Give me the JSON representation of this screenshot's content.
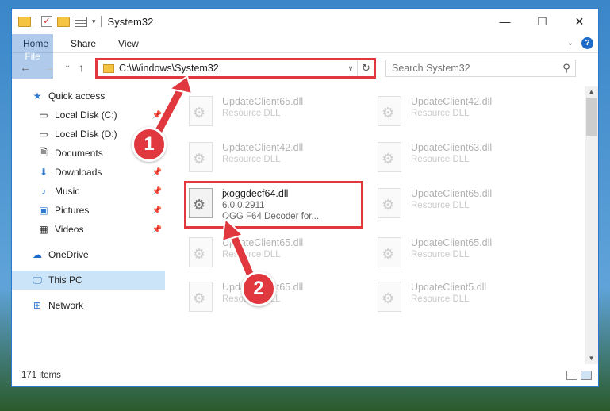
{
  "window": {
    "title": "System32",
    "controls": {
      "minimize": "—",
      "maximize": "☐",
      "close": "✕"
    }
  },
  "ribbon": {
    "tabs": [
      "File",
      "Home",
      "Share",
      "View"
    ],
    "expand_icon": "chevron-down-icon",
    "help": "?"
  },
  "nav": {
    "back": "←",
    "forward": "→",
    "recent": "⌄",
    "up": "↑",
    "address": "C:\\Windows\\System32",
    "search_placeholder": "Search System32"
  },
  "sidebar": {
    "items": [
      {
        "label": "Quick access",
        "icon": "star-icon",
        "pinned": false
      },
      {
        "label": "Local Disk (C:)",
        "icon": "drive-icon",
        "pinned": true
      },
      {
        "label": "Local Disk (D:)",
        "icon": "drive-icon",
        "pinned": true
      },
      {
        "label": "Documents",
        "icon": "documents-icon",
        "pinned": true
      },
      {
        "label": "Downloads",
        "icon": "download-icon",
        "pinned": true
      },
      {
        "label": "Music",
        "icon": "music-icon",
        "pinned": true
      },
      {
        "label": "Pictures",
        "icon": "pictures-icon",
        "pinned": true
      },
      {
        "label": "Videos",
        "icon": "videos-icon",
        "pinned": true
      },
      {
        "label": "OneDrive",
        "icon": "cloud-icon",
        "pinned": false
      },
      {
        "label": "This PC",
        "icon": "computer-icon",
        "pinned": false,
        "selected": true
      },
      {
        "label": "Network",
        "icon": "network-icon",
        "pinned": false
      }
    ]
  },
  "files": [
    {
      "name": "UpdateClient65.dll",
      "type": "Resource DLL"
    },
    {
      "name": "UpdateClient42.dll",
      "type": "Resource DLL"
    },
    {
      "name": "UpdateClient42.dll",
      "type": "Resource DLL"
    },
    {
      "name": "UpdateClient63.dll",
      "type": "Resource DLL"
    },
    {
      "name": "jxoggdecf64.dll",
      "version": "6.0.0.2911",
      "type": "OGG F64 Decoder for...",
      "highlighted": true
    },
    {
      "name": "UpdateClient65.dll",
      "type": "Resource DLL"
    },
    {
      "name": "UpdateClient65.dll",
      "type": "Resource DLL"
    },
    {
      "name": "UpdateClient65.dll",
      "type": "Resource DLL"
    },
    {
      "name": "UpdateClient65.dll",
      "type": "Resource DLL"
    },
    {
      "name": "UpdateClient5.dll",
      "type": "Resource DLL"
    }
  ],
  "status": {
    "item_count": "171 items"
  },
  "callouts": {
    "one": "1",
    "two": "2"
  },
  "colors": {
    "accent": "#1e6bc7",
    "highlight": "#e0383e",
    "selected": "#cce4f7"
  }
}
